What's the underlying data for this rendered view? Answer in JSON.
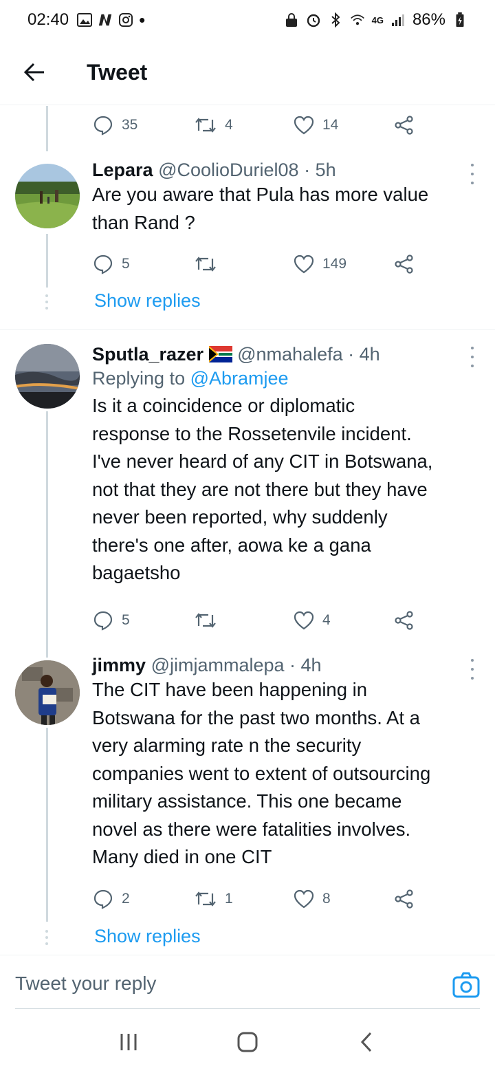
{
  "status_bar": {
    "time": "02:40",
    "network": "4G",
    "battery": "86%"
  },
  "header": {
    "title": "Tweet"
  },
  "top_actions": {
    "replies": "35",
    "retweets": "4",
    "likes": "14"
  },
  "tweets": [
    {
      "name": "Lepara",
      "handle": "@CoolioDuriel08",
      "time": "· 5h",
      "text_lines": [
        "Are you aware that Pula has more value",
        "than Rand ?"
      ],
      "replies": "5",
      "retweets": "",
      "likes": "149",
      "show_replies": "Show replies"
    },
    {
      "name": "Sputla_razer",
      "handle": "@nmahalefa",
      "time": "· 4h",
      "replying_label": "Replying to",
      "replying_to": "@Abramjee",
      "text_lines": [
        "Is it a coincidence or diplomatic",
        "response to the Rossetenvile incident.",
        "I've never heard of any CIT in Botswana,",
        "not that they are not there but they have",
        "never been reported, why suddenly",
        "there's one after, aowa ke a gana",
        "bagaetsho"
      ],
      "replies": "5",
      "retweets": "",
      "likes": "4"
    },
    {
      "name": "jimmy",
      "handle": "@jimjammalepa",
      "time": "· 4h",
      "text_lines": [
        "The CIT have been happening in",
        "Botswana for the past two months. At a",
        "very alarming rate n the security",
        "companies went to extent of outsourcing",
        "military assistance. This one became",
        "novel as there were fatalities involves.",
        "Many died in one CIT"
      ],
      "replies": "2",
      "retweets": "1",
      "likes": "8",
      "show_replies": "Show replies"
    }
  ],
  "compose": {
    "placeholder": "Tweet your reply"
  },
  "icons": {
    "back": "arrow-left-icon",
    "reply": "reply-icon",
    "retweet": "retweet-icon",
    "like": "heart-icon",
    "share": "share-icon",
    "camera": "camera-icon",
    "flag": "south-africa-flag-icon"
  },
  "colors": {
    "link": "#1d9bf0",
    "secondary": "#536471",
    "text": "#0f1419"
  }
}
